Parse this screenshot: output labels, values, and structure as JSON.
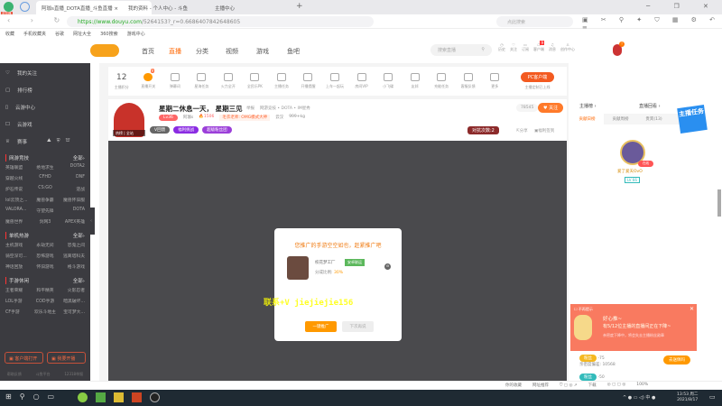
{
  "browser": {
    "tabs": [
      {
        "label": "阿珈s直播_DOTA直播_斗鱼直播"
      },
      {
        "label": "我的资料 - 个人中心 - 斗鱼"
      },
      {
        "label": "主播中心"
      }
    ],
    "badge": "浏览器",
    "url_host": "https://www.douyu.com",
    "url_path": "/5264153?_r=0.6686407842648605",
    "search_placeholder": "点此搜索",
    "bookmarks": [
      "收藏",
      "手机收藏夹",
      "谷歌",
      "网址大全",
      "360搜索",
      "游戏中心"
    ]
  },
  "site": {
    "nav": [
      "首页",
      "直播",
      "分类",
      "视频",
      "游戏",
      "鱼吧"
    ],
    "search_placeholder": "搜索直播",
    "header_icons": [
      "历史",
      "关注",
      "订阅",
      "客户端",
      "消息",
      "创作中心"
    ],
    "msg_badge": "9",
    "avatar_badge": "!"
  },
  "sidebar": {
    "items": [
      "我的关注",
      "排行榜",
      "云游中心",
      "云游戏",
      "赛事"
    ],
    "sections": [
      {
        "title": "网游竞技",
        "more": "全部›",
        "items": [
          "英雄联盟",
          "绝地求生",
          "DOTA2",
          "穿越火线",
          "CFHD",
          "DNF",
          "炉石传说",
          "CS:GO",
          "逆战",
          "lol云顶之...",
          "魔兽争霸",
          "魔兽怀旧服",
          "VALORA...",
          "守望先锋",
          "DOTA",
          "魔兽世界",
          "剑网3",
          "APEX英雄"
        ]
      },
      {
        "title": "单机热游",
        "more": "全部›",
        "items": [
          "主机游戏",
          "永劫无间",
          "恐鬼之间",
          "骑空深可...",
          "恐怖游戏",
          "逃离塔科夫",
          "神话回放",
          "怀旧游戏",
          "格斗游戏"
        ]
      },
      {
        "title": "手游休闲",
        "more": "全部›",
        "items": [
          "王者荣耀",
          "和平精英",
          "火影忍者",
          "LOL手游",
          "COD手游",
          "暗黑破坏...",
          "CF手游",
          "欢乐斗地主",
          "宝可梦大..."
        ]
      }
    ],
    "open_client": "客户端打开",
    "start_live": "我要开播",
    "footer": [
      "帮助反馈",
      "斗鱼平台",
      "12318举报"
    ]
  },
  "toolbar": {
    "points_value": "12",
    "points_label": "主播积分",
    "switch_badge": "9",
    "items": [
      "直播开关",
      "弹幕词",
      "星海任务",
      "火力全开",
      "全民乐PK",
      "主播任务",
      "开播提醒",
      "上车一起玩",
      "房间VIP",
      "小飞碟",
      "友邦",
      "充能任务",
      "客服反馈",
      "更多"
    ],
    "pc_client": "PC客户端",
    "pc_sub": "主播定制已上线"
  },
  "room": {
    "title": "星期二休息一天， 星期三见",
    "report": "举报",
    "category": "网游竞技 • DOTA • IM星秀",
    "level": "Lv36",
    "name": "阿珈s",
    "heat": "1506",
    "tag": "毛衣老师: OMG模式大神",
    "city": "云汉",
    "weight": "999+kg",
    "followers": "78545",
    "follow": "关注",
    "badges": [
      "V回馈",
      "福利挑战",
      "超级粉丝团"
    ],
    "fans": "热榜",
    "rank": "全站",
    "event": "对抗次数:2",
    "share": "分享",
    "sign": "福利签到"
  },
  "right": {
    "links": [
      "主播榜 ›",
      "直播回看 ›"
    ],
    "tabs": [
      "贡献日榜",
      "贡献周榜",
      "贵宾(13)",
      "钻石"
    ],
    "top_user": "爱了爱天OvO",
    "top_level": "LV 66",
    "online": "在线",
    "task_badge": "主播任务",
    "notice": {
      "dismiss": "不再提示",
      "title": "好心推~",
      "body": "有5/12位主播的直播间正在下降~",
      "sub": "亲密度下降中，将会失去主播粉丝勋章"
    },
    "rows": [
      {
        "delta": "-75",
        "intimacy": "亲密度偏差: 10568",
        "action": "去送佩吗"
      },
      {
        "delta": "-50"
      }
    ]
  },
  "modal": {
    "title": "您推广的手游空空如也，赶紧推广吧",
    "game": "校花梦工厂",
    "tag": "安卓联运",
    "ratio_label": "分成比例:",
    "ratio": "30%",
    "watermark": "联系+V jiejiejie156",
    "primary": "一键推广",
    "secondary": "下次再说"
  },
  "status": {
    "items": [
      "你的收藏",
      "网址推荐",
      "下载"
    ],
    "zoom": "100%"
  },
  "taskbar": {
    "time": "13:53 周二",
    "date": "2021/8/17"
  },
  "colors": {
    "accent": "#ff7700",
    "sidebar": "#3b3b40",
    "video": "#4a4a4d"
  }
}
